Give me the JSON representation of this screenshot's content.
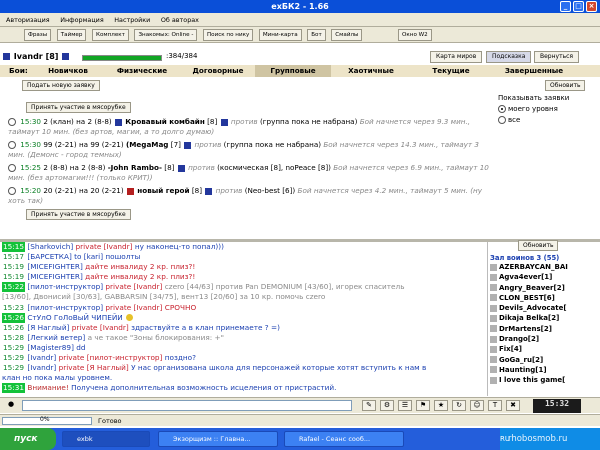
{
  "window": {
    "title": "exБК2 - 1.66"
  },
  "menu": {
    "items": [
      "Авторизация",
      "Информация",
      "Настройки",
      "Об авторах"
    ]
  },
  "toolbar": {
    "items": [
      "Фразы",
      "Таймер",
      "Комплект",
      "Знакомых: Online -",
      "Поиск по нику",
      "Мини-карта",
      "Бот",
      "Смайлы",
      "Окно W2"
    ]
  },
  "player": {
    "name": "Ivandr",
    "level": "[8]",
    "hp_text": ":384/384",
    "hp_fraction": 1.0
  },
  "top_buttons": {
    "world_map": "Карта миров",
    "hint": "Подсказка",
    "back": "Вернуться"
  },
  "tabs": {
    "label": "Бои:",
    "items": [
      "Новичков",
      "Физические",
      "Договорные",
      "Групповые",
      "Хаотичные",
      "Текущие",
      "Завершенные"
    ],
    "active": "Групповые"
  },
  "buttons": {
    "new_request": "Подать новую заявку",
    "refresh": "Обновить",
    "join_top": "Принять участие в мясорубке",
    "join_bottom": "Принять участие в мясорубке",
    "refresh_chat": "Обновить"
  },
  "show_requests": {
    "title": "Показывать заявки",
    "options": [
      "моего уровня",
      "все"
    ],
    "selected": "моего уровня"
  },
  "applications": [
    {
      "time": "15:30",
      "text": "2 (клан) на 2 (8-8)",
      "fighter": "Кровавый комбайн",
      "fighter_level": "[8]",
      "vs": "против",
      "opp": "(группа пока не набрана)",
      "note": "Бой начнется через 9.3 мин., таймаут 10 мин. (без артов, магии, а то долго думаю)"
    },
    {
      "time": "15:30",
      "text": "99 (2-21) на 99 (2-21)",
      "fighter": "(MegaMag",
      "fighter_level": "[7]",
      "vs": "против",
      "opp": "(группа пока не набрана)",
      "note": "Бой начнется через 14.3 мин., таймаут 3 мин. (Демонс - город темных)"
    },
    {
      "time": "15:25",
      "text": "2 (8-8) на 2 (8-8)",
      "fighter": "-John Rambo-",
      "fighter_level": "[8]",
      "vs": "против",
      "opp": "(космическая [8], noPeace [8])",
      "note": "Бой начнется через 6.9 мин., таймаут 10 мин. (без артомагии!!! (только КРИТ))"
    },
    {
      "time": "15:20",
      "text": "20 (2-21) на 20 (2-21)",
      "fighter": "новый герой",
      "fighter_level": "[8]",
      "vs": "против",
      "opp": "(Neo-best [6])",
      "note": "Бой начнется через 4.2 мин., таймаут 5 мин. (ну хоть так)"
    }
  ],
  "chat": [
    {
      "time": "15:15",
      "hl": true,
      "parts": [
        {
          "t": "[Sharkovich] ",
          "c": "nick"
        },
        {
          "t": "private [Ivandr] ",
          "c": "pv"
        },
        {
          "t": "ну наконец-то попал)))",
          "c": "nick"
        }
      ]
    },
    {
      "time": "15:17",
      "hl": false,
      "parts": [
        {
          "t": "[БАРСЕТКА] ",
          "c": "nick"
        },
        {
          "t": "to [kari] пошолты",
          "c": "nick"
        }
      ]
    },
    {
      "time": "15:19",
      "hl": false,
      "parts": [
        {
          "t": "[MICEFIGHTER] ",
          "c": "nick"
        },
        {
          "t": "дайте инвалиду 2 кр. плиз?!",
          "c": "pv"
        }
      ]
    },
    {
      "time": "15:19",
      "hl": false,
      "parts": [
        {
          "t": "[MICEFIGHTER] ",
          "c": "nick"
        },
        {
          "t": "дайте инвалиду 2 кр. плиз?!",
          "c": "pv"
        }
      ]
    },
    {
      "time": "15:22",
      "hl": true,
      "parts": [
        {
          "t": "[пилот-инструктор] ",
          "c": "nick"
        },
        {
          "t": "private [Ivandr] ",
          "c": "pv"
        },
        {
          "t": "czero [44/63] против Pan DEMONIUM [43/60], игорек спаситель",
          "c": "gr"
        }
      ]
    },
    {
      "time": "",
      "hl": false,
      "parts": [
        {
          "t": "[13/60], Двонисий [30/63], GABBARSIN [34/75], вент13 [20/60] за 10 кр. помочь czero",
          "c": "gr"
        }
      ]
    },
    {
      "time": "15:23",
      "hl": false,
      "parts": [
        {
          "t": "[пилот-инструктор] ",
          "c": "nick"
        },
        {
          "t": "private [Ivandr] ",
          "c": "pv"
        },
        {
          "t": "СРОЧНО",
          "c": "pv"
        }
      ]
    },
    {
      "time": "15:26",
      "hl": true,
      "parts": [
        {
          "t": "СтУлО ГоЛоВыЙ ЧИПЕЙИ",
          "c": "nick"
        }
      ]
    },
    {
      "time": "15:26",
      "hl": false,
      "parts": [
        {
          "t": "[Я Наглый] ",
          "c": "nick"
        },
        {
          "t": "private [Ivandr] ",
          "c": "pv"
        },
        {
          "t": "здраствуйте а в клан принемаете ? =)",
          "c": "nick"
        }
      ]
    },
    {
      "time": "15:28",
      "hl": false,
      "parts": [
        {
          "t": "[Легкий ветер] ",
          "c": "nick"
        },
        {
          "t": "а че такое \"Зоны блокирования: +\"",
          "c": "gr"
        }
      ]
    },
    {
      "time": "15:29",
      "hl": false,
      "parts": [
        {
          "t": "[Magister89] ",
          "c": "nick"
        },
        {
          "t": "dd",
          "c": "nick"
        }
      ]
    },
    {
      "time": "15:29",
      "hl": false,
      "parts": [
        {
          "t": "[Ivandr] ",
          "c": "nick"
        },
        {
          "t": "private [пилот-инструктор] ",
          "c": "pv"
        },
        {
          "t": "поздно?",
          "c": "nick"
        }
      ]
    },
    {
      "time": "15:29",
      "hl": false,
      "parts": [
        {
          "t": "[Ivandr] ",
          "c": "nick"
        },
        {
          "t": "private [Я Наглый] ",
          "c": "pv"
        },
        {
          "t": "У нас организована школа для персонажей которые хотят вступить к нам в",
          "c": "nick"
        }
      ]
    },
    {
      "time": "",
      "hl": false,
      "parts": [
        {
          "t": "клан но пока малы уровнем.",
          "c": "nick"
        }
      ]
    },
    {
      "time": "15:31",
      "hl": true,
      "parts": [
        {
          "t": "Внимание! ",
          "c": "sys"
        },
        {
          "t": "Получена дополнительная возможность исцеления от пристрастий.",
          "c": "nick"
        }
      ]
    }
  ],
  "location": {
    "title": "Зал воинов 3 (55)"
  },
  "online_users": [
    "AZERBAYCAN_BAI",
    "Agva4ever[1]",
    "Angry_Beaver[2]",
    "CLON_BEST[6]",
    "Devils_Advocate[",
    "Dikaja Belka[2]",
    "DrMartens[2]",
    "Drango[2]",
    "Fix[4]",
    "GoGa_ru[2]",
    "Haunting[1]",
    "I love this game["
  ],
  "bottom": {
    "clock": "15:32",
    "progress_pct": "0%",
    "status": "Готово"
  },
  "taskbar": {
    "start": "пуск",
    "tasks": [
      "exbk",
      "Экзорщизм :: Главна...",
      "Rafael - Сеанс сооб..."
    ],
    "lang": "RU",
    "watermark": "rhobosmob.ru"
  }
}
